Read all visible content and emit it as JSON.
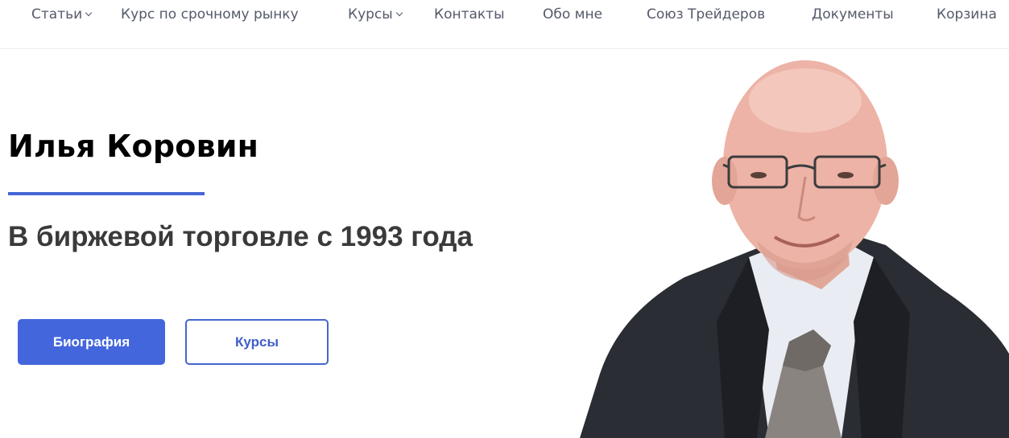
{
  "nav": {
    "items": [
      {
        "label": "Статьи",
        "has_dropdown": true
      },
      {
        "label": "Курс по срочному рынку",
        "has_dropdown": false
      },
      {
        "label": "Курсы",
        "has_dropdown": true
      },
      {
        "label": "Контакты",
        "has_dropdown": false
      },
      {
        "label": "Обо мне",
        "has_dropdown": false
      },
      {
        "label": "Союз Трейдеров",
        "has_dropdown": false
      },
      {
        "label": "Документы",
        "has_dropdown": false
      },
      {
        "label": "Корзина",
        "has_dropdown": false
      }
    ]
  },
  "hero": {
    "title": "Илья Коровин",
    "subtitle": "В биржевой торговле с 1993 года",
    "primary_button": "Биография",
    "secondary_button": "Курсы"
  },
  "colors": {
    "accent": "#4466dd",
    "title_text": "#000000",
    "subtitle_text": "#3a3a3a",
    "nav_text": "#555a6a"
  }
}
